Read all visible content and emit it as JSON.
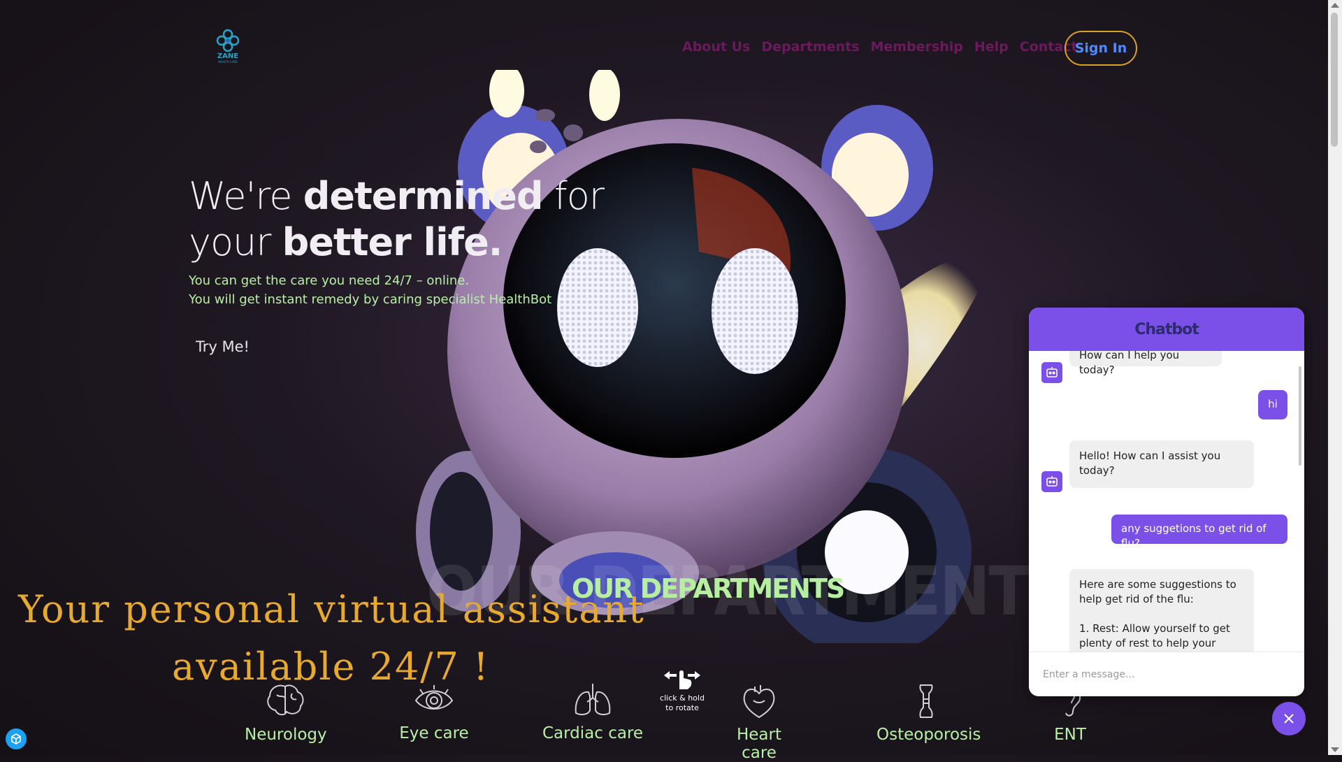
{
  "brand": {
    "name": "ZANE",
    "subtitle": "HEALTH CARE",
    "logo_icon": "medical-cross-icon"
  },
  "nav": {
    "items": [
      "About Us",
      "Departments",
      "Membership",
      "Help",
      "Contact"
    ],
    "sign_in": "Sign In"
  },
  "hero": {
    "title_1": "We're ",
    "title_bold_1": "determined",
    "title_2": " for",
    "title_3": "your ",
    "title_bold_2": "better life.",
    "sub_1": "You can get the care you need 24/7 – online.",
    "sub_2": "You will get instant remedy by caring specialist HealthBot",
    "try_button": "Try Me!"
  },
  "departments": {
    "ghost_title": "OUR DEPARTMENTS",
    "title": "OUR DEPARTMENTS",
    "items": [
      {
        "label": "Neurology",
        "icon": "brain-icon"
      },
      {
        "label": "Eye care",
        "icon": "eye-icon"
      },
      {
        "label": "Cardiac care",
        "icon": "lungs-icon"
      },
      {
        "label": "Heart care",
        "icon": "heart-icon"
      },
      {
        "label": "Osteoporosis",
        "icon": "bone-icon"
      },
      {
        "label": "ENT",
        "icon": "ear-icon"
      }
    ]
  },
  "tagline": {
    "line_1": "Your personal virtual  assistant",
    "line_2": "available 24/7 !"
  },
  "rotate_hint": {
    "line_1": "click & hold",
    "line_2": "to rotate",
    "icon": "hand-drag-icon"
  },
  "chatbot": {
    "title": "Chatbot",
    "messages": [
      {
        "from": "bot",
        "text": "How can I help you today?"
      },
      {
        "from": "user",
        "text": "hi"
      },
      {
        "from": "bot",
        "text": "Hello! How can I assist you today?"
      },
      {
        "from": "user",
        "text": "any suggetions to get rid of flu?"
      },
      {
        "from": "bot",
        "text": "Here are some suggestions to help get rid of the flu:\n\n1. Rest: Allow yourself to get plenty of rest to help your body recover"
      }
    ],
    "input_placeholder": "Enter a message...",
    "close_icon": "close-icon"
  },
  "colors": {
    "accent": "#7a50e8",
    "nav": "#6b1a5c",
    "highlight": "#b8f0a5",
    "tagline": "#e8a92f",
    "signin_border": "#d9a21f"
  }
}
